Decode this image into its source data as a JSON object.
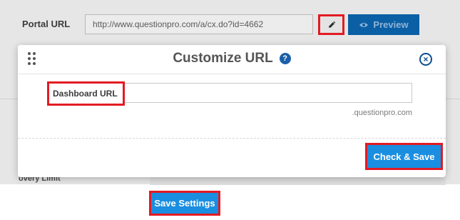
{
  "background": {
    "portal_url_label": "Portal URL",
    "portal_url_value": "http://www.questionpro.com/a/cx.do?id=4662",
    "preview_label": "Preview",
    "bottom_label": "overy Limit",
    "save_settings_label": "Save Settings",
    "icons": {
      "edit": "pencil-icon",
      "preview": "eye-icon"
    }
  },
  "modal": {
    "title": "Customize URL",
    "help_icon_glyph": "?",
    "close_glyph": "×",
    "field_label": "Dashboard URL",
    "field_value": "",
    "domain_suffix": ".questionpro.com",
    "check_save_label": "Check & Save",
    "icons": {
      "drag": "drag-handle-icon",
      "help": "question-circle-icon",
      "close": "close-circle-icon"
    }
  },
  "colors": {
    "highlight": "#e31b23",
    "primary_button": "#1a8ee0",
    "preview_button": "#0b5fa5",
    "help_icon": "#1a5fa8"
  }
}
